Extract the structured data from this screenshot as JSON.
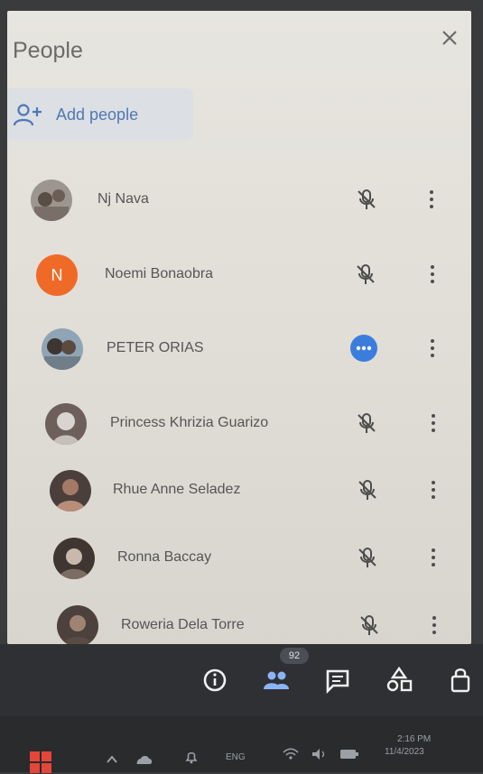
{
  "panel": {
    "title": "People",
    "add_people_label": "Add people"
  },
  "participants": [
    {
      "name": "Nj Nava",
      "avatar": "photo",
      "status": "muted"
    },
    {
      "name": "Noemi Bonaobra",
      "avatar": "N",
      "status": "muted"
    },
    {
      "name": "PETER ORIAS",
      "avatar": "photo",
      "status": "speaking"
    },
    {
      "name": "Princess Khrizia Guarizo",
      "avatar": "photo",
      "status": "muted"
    },
    {
      "name": "Rhue Anne Seladez",
      "avatar": "photo",
      "status": "muted"
    },
    {
      "name": "Ronna Baccay",
      "avatar": "photo",
      "status": "muted"
    },
    {
      "name": "Roweria Dela Torre",
      "avatar": "photo",
      "status": "muted"
    }
  ],
  "toolbar": {
    "people_count": "92"
  },
  "taskbar": {
    "language": "ENG",
    "time": "2:16 PM",
    "date": "11/4/2023"
  }
}
